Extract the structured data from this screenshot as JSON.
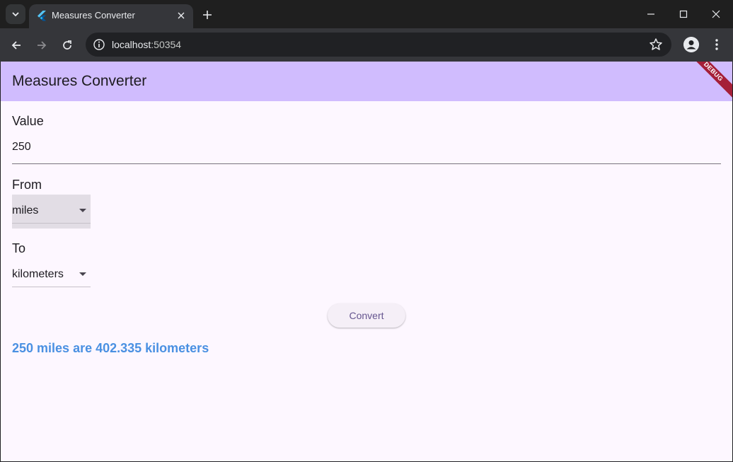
{
  "browser": {
    "tab": {
      "title": "Measures Converter"
    },
    "url": {
      "host": "localhost",
      "port": ":50354"
    }
  },
  "app": {
    "title": "Measures Converter",
    "debug_banner": "DEBUG",
    "value_label": "Value",
    "value": "250",
    "from_label": "From",
    "from_selected": "miles",
    "to_label": "To",
    "to_selected": "kilometers",
    "convert_label": "Convert",
    "result": "250 miles are 402.335 kilometers"
  },
  "colors": {
    "appbar": "#d0bcfe",
    "background": "#fdf7ff",
    "result_text": "#4a90e2",
    "debug_banner": "#a51f38"
  }
}
